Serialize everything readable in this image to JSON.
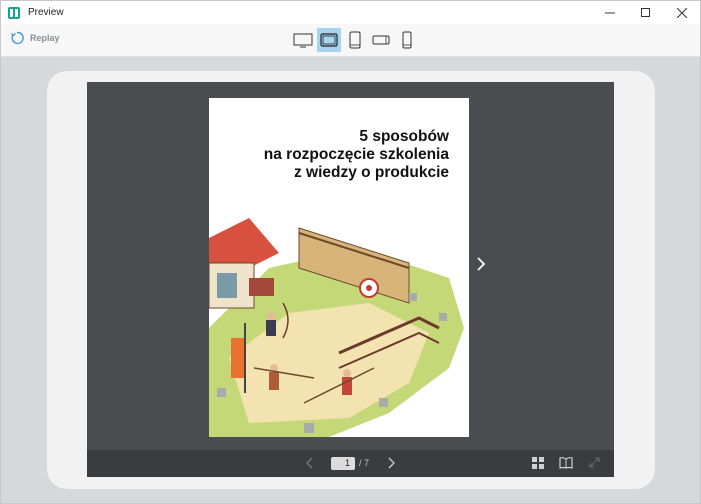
{
  "window": {
    "title": "Preview"
  },
  "toolbar": {
    "replay_label": "Replay",
    "devices": [
      "desktop-icon",
      "tablet-landscape-icon",
      "tablet-portrait-icon",
      "phone-landscape-icon",
      "phone-portrait-icon"
    ],
    "active_device": "tablet-landscape-icon"
  },
  "document": {
    "title_lines": [
      "5 sposobów",
      "na rozpoczęcie szkolenia",
      "z wiedzy o produkcie"
    ]
  },
  "pager": {
    "current_page": "1",
    "separator": "/ 7"
  },
  "colors": {
    "accent": "#a8d4ef",
    "viewer_bg": "#4a4c4f",
    "stage_bg": "#d6d8da"
  }
}
